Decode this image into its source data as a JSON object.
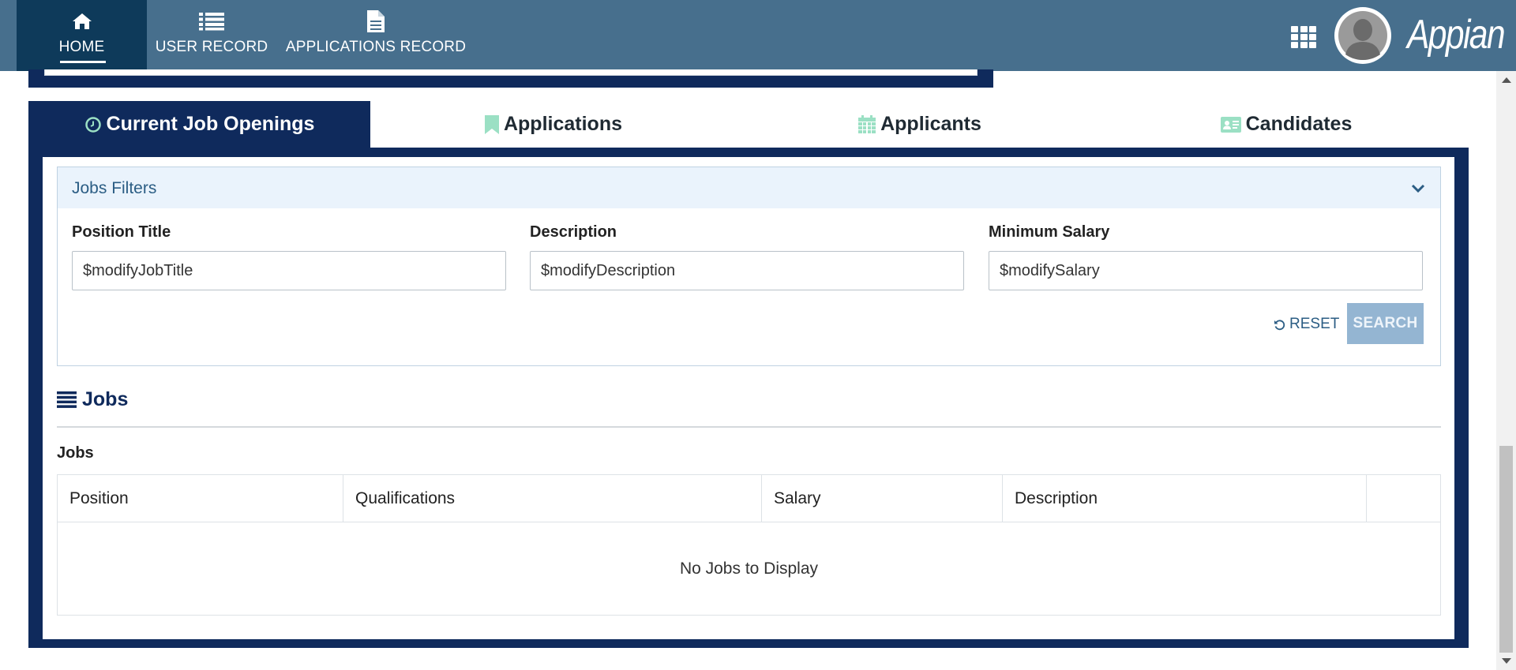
{
  "nav": {
    "items": [
      {
        "label": "HOME",
        "icon": "home-icon"
      },
      {
        "label": "USER RECORD",
        "icon": "list-icon"
      },
      {
        "label": "APPLICATIONS RECORD",
        "icon": "document-icon"
      }
    ],
    "active": "HOME",
    "brand": "Appian"
  },
  "tabs": [
    {
      "label": "Current Job Openings",
      "icon": "clock-icon",
      "active": true
    },
    {
      "label": "Applications",
      "icon": "bookmark-icon",
      "active": false
    },
    {
      "label": "Applicants",
      "icon": "calendar-icon",
      "active": false
    },
    {
      "label": "Candidates",
      "icon": "id-card-icon",
      "active": false
    }
  ],
  "filters": {
    "title": "Jobs Filters",
    "fields": [
      {
        "label": "Position Title",
        "value": "$modifyJobTitle"
      },
      {
        "label": "Description",
        "value": "$modifyDescription"
      },
      {
        "label": "Minimum Salary",
        "value": "$modifySalary"
      }
    ],
    "reset_label": "RESET",
    "search_label": "SEARCH"
  },
  "jobs": {
    "heading": "Jobs",
    "grid_label": "Jobs",
    "columns": [
      "Position",
      "Qualifications",
      "Salary",
      "Description",
      ""
    ],
    "empty_text": "No Jobs to Display"
  },
  "colors": {
    "topbar": "#476f8d",
    "nav_active": "#0e3a5a",
    "panel": "#0f2a5c",
    "filter_header": "#eaf3fc",
    "search_button": "#94b5d2",
    "tab_icon": "#9be0c4"
  }
}
